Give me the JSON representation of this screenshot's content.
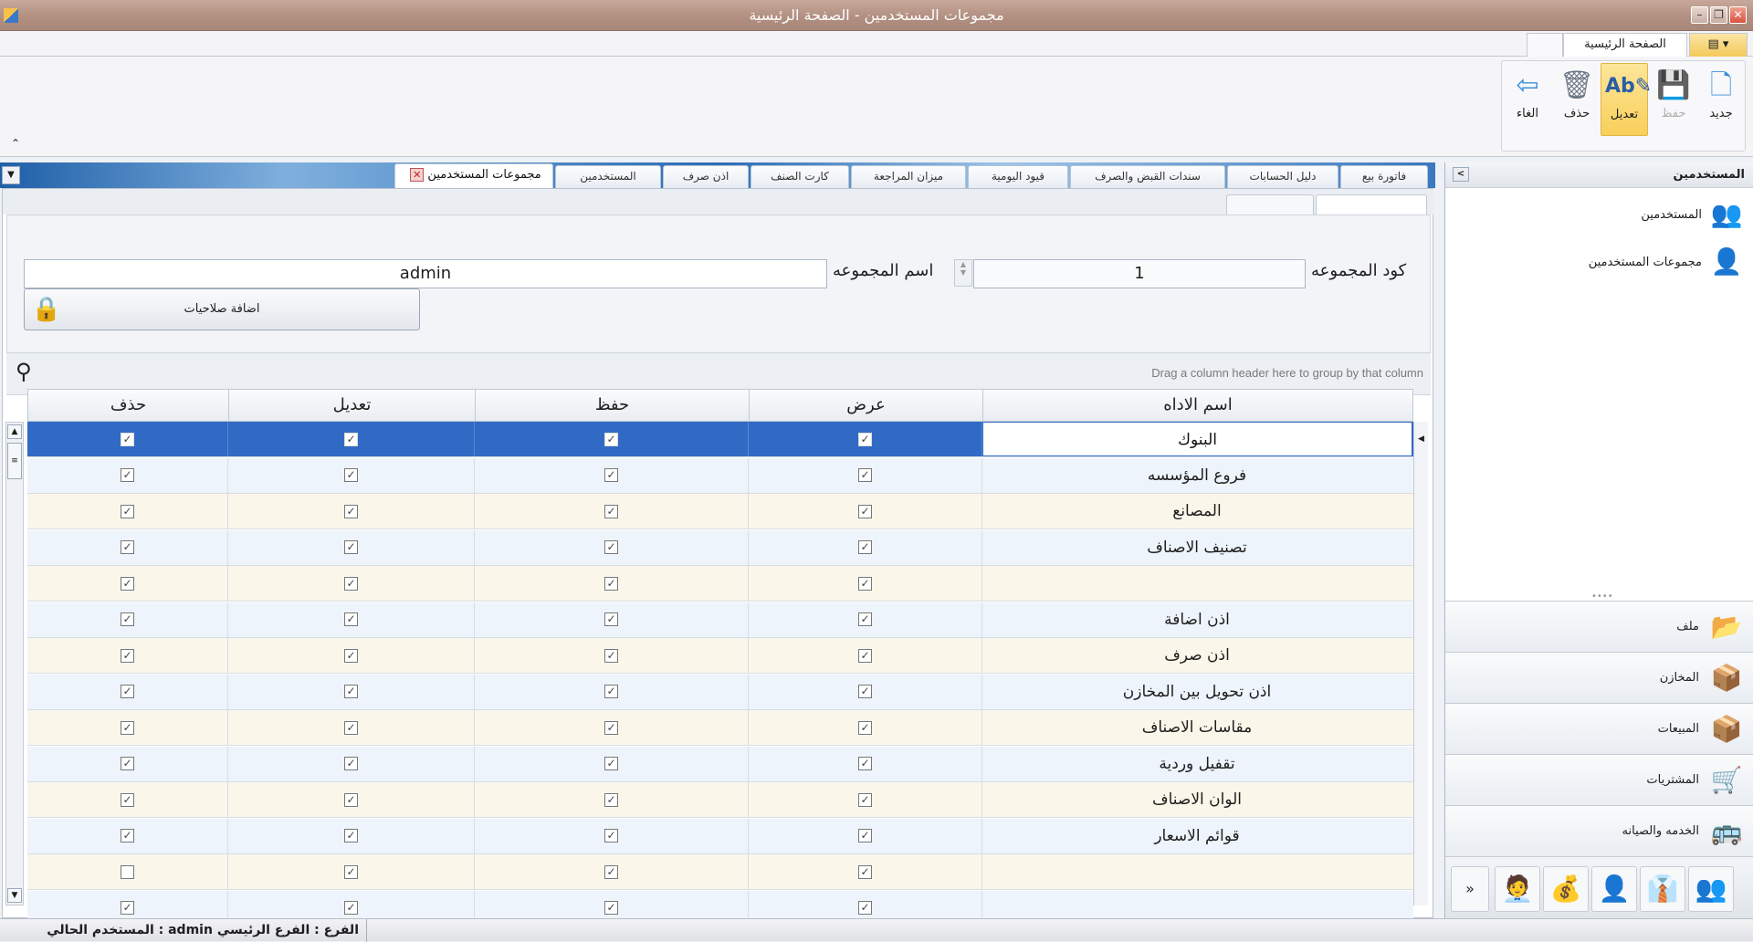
{
  "window": {
    "title": "مجموعات المستخدمين - الصفحة الرئيسية"
  },
  "ribbon": {
    "home_tab": "الصفحة الرئيسية",
    "buttons": {
      "new": "جديد",
      "save": "حفظ",
      "edit": "تعديل",
      "delete": "حذف",
      "cancel": "الغاء"
    }
  },
  "nav": {
    "header": "المستخدمين",
    "items": [
      "المستخدمين",
      "مجموعات المستخدمين"
    ],
    "sections": [
      "ملف",
      "المخازن",
      "المبيعات",
      "المشتريات",
      "الخدمه والصيانه"
    ]
  },
  "doc_tabs": [
    "فاتورة بيع",
    "دليل الحسابات",
    "سندات القبض والصرف",
    "قيود اليومية",
    "ميزان المراجعة",
    "كارت الصنف",
    "اذن صرف",
    "المستخدمين",
    "مجموعات المستخدمين"
  ],
  "form": {
    "code_label": "كود المجموعه",
    "code_value": "1",
    "name_label": "اسم المجموعه",
    "name_value": "admin",
    "perm_button": "اضافة صلاحيات"
  },
  "group_hint": "Drag a column header here to group by that column",
  "grid": {
    "columns": {
      "name": "اسم الاداه",
      "view": "عرض",
      "save": "حفظ",
      "edit": "تعديل",
      "delete": "حذف"
    },
    "rows": [
      {
        "name": "البنوك",
        "view": true,
        "save": true,
        "edit": true,
        "delete": true
      },
      {
        "name": "فروع المؤسسه",
        "view": true,
        "save": true,
        "edit": true,
        "delete": true
      },
      {
        "name": "المصانع",
        "view": true,
        "save": true,
        "edit": true,
        "delete": true
      },
      {
        "name": "تصنيف الاصناف",
        "view": true,
        "save": true,
        "edit": true,
        "delete": true
      },
      {
        "name": "",
        "view": true,
        "save": true,
        "edit": true,
        "delete": true
      },
      {
        "name": "اذن اضافة",
        "view": true,
        "save": true,
        "edit": true,
        "delete": true
      },
      {
        "name": "اذن صرف",
        "view": true,
        "save": true,
        "edit": true,
        "delete": true
      },
      {
        "name": "اذن تحويل بين المخازن",
        "view": true,
        "save": true,
        "edit": true,
        "delete": true
      },
      {
        "name": "مقاسات الاصناف",
        "view": true,
        "save": true,
        "edit": true,
        "delete": true
      },
      {
        "name": "تقفيل وردية",
        "view": true,
        "save": true,
        "edit": true,
        "delete": true
      },
      {
        "name": "الوان الاصناف",
        "view": true,
        "save": true,
        "edit": true,
        "delete": true
      },
      {
        "name": "قوائم الاسعار",
        "view": true,
        "save": true,
        "edit": true,
        "delete": true
      },
      {
        "name": "",
        "view": true,
        "save": true,
        "edit": true,
        "delete": false
      },
      {
        "name": "",
        "view": true,
        "save": true,
        "edit": true,
        "delete": true
      }
    ]
  },
  "status": {
    "text": "المستخدم الحالي : admin   الفرع  :  الفرع الرئيسي"
  }
}
